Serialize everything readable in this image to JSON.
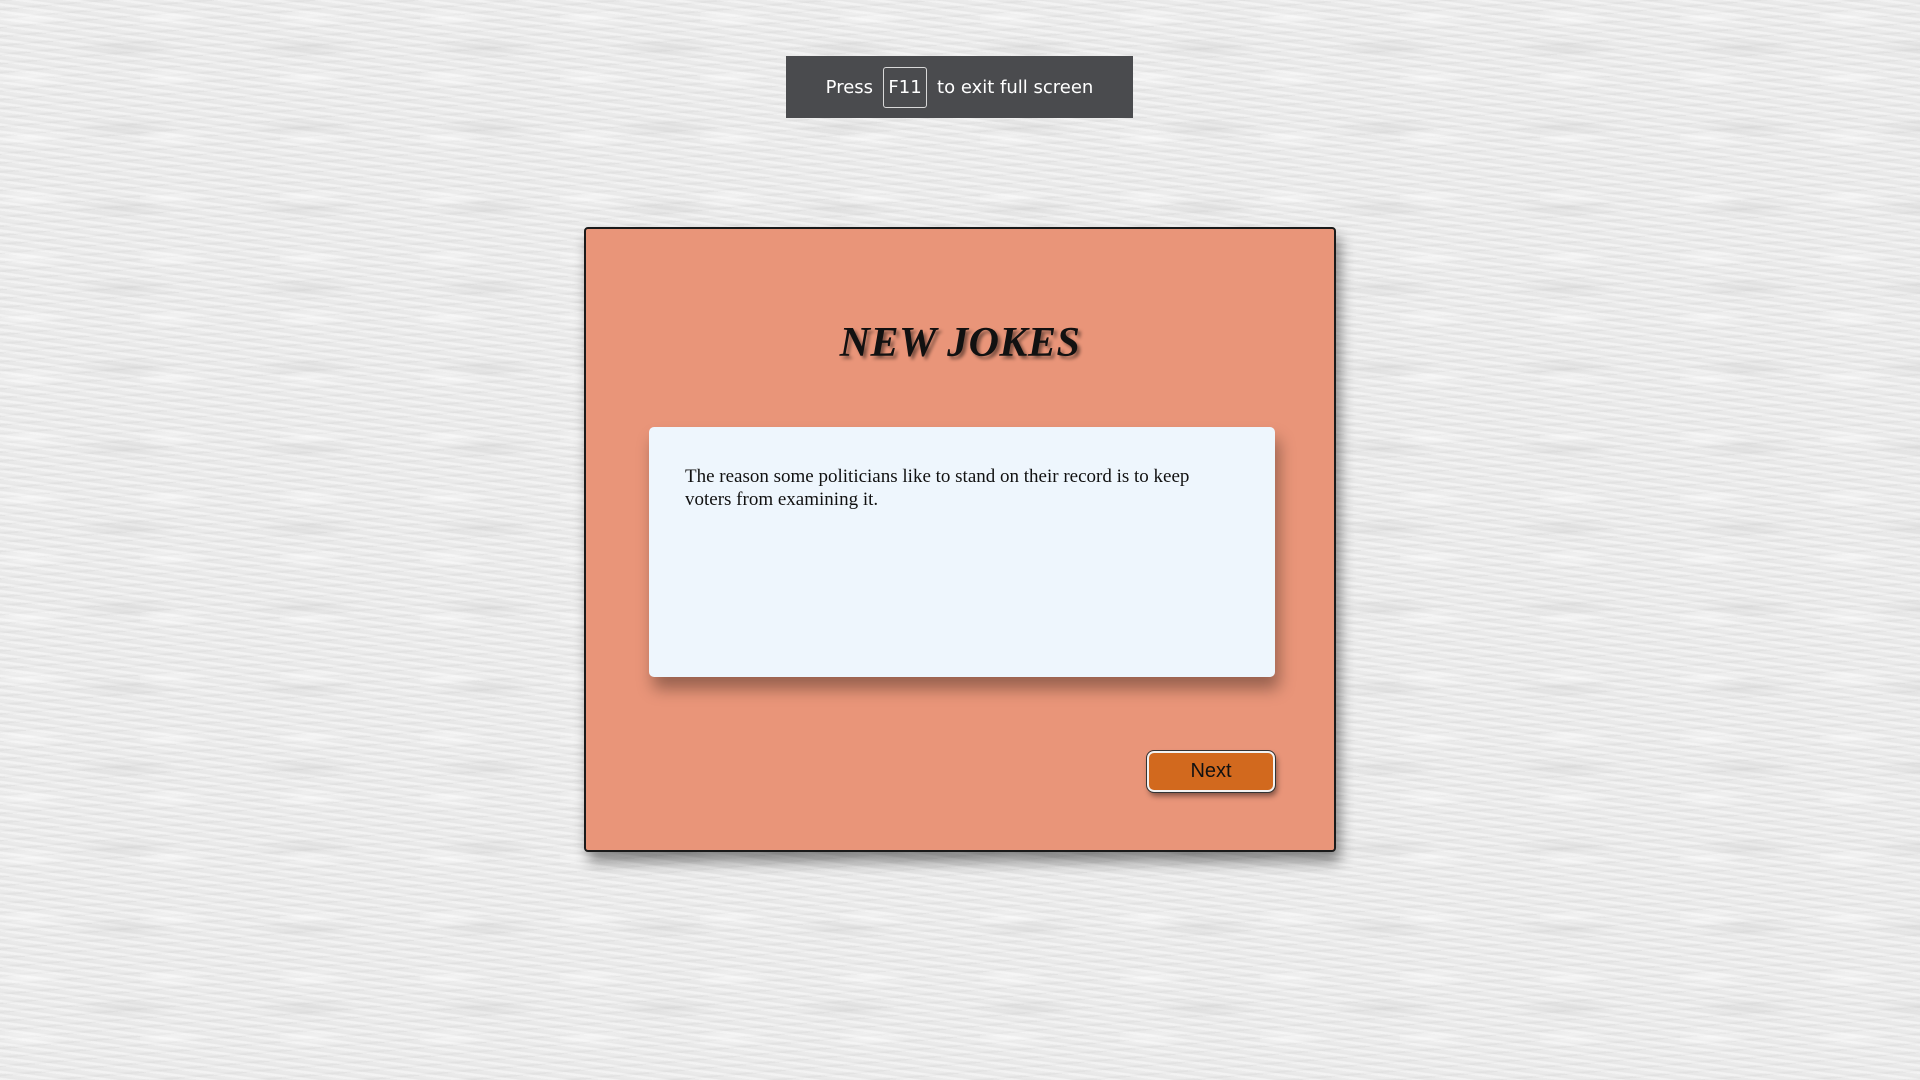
{
  "fullscreen_notice": {
    "prefix": "Press",
    "key": "F11",
    "suffix": "to exit full screen"
  },
  "card": {
    "title": "NEW JOKES",
    "joke": "The reason some politicians like to stand on their record is to keep voters from examining it.",
    "next_label": "Next"
  },
  "colors": {
    "card_background": "#e99579",
    "joke_box_background": "#eef6fd",
    "button_background": "#d2691e",
    "notice_background": "#4a4b4e"
  }
}
